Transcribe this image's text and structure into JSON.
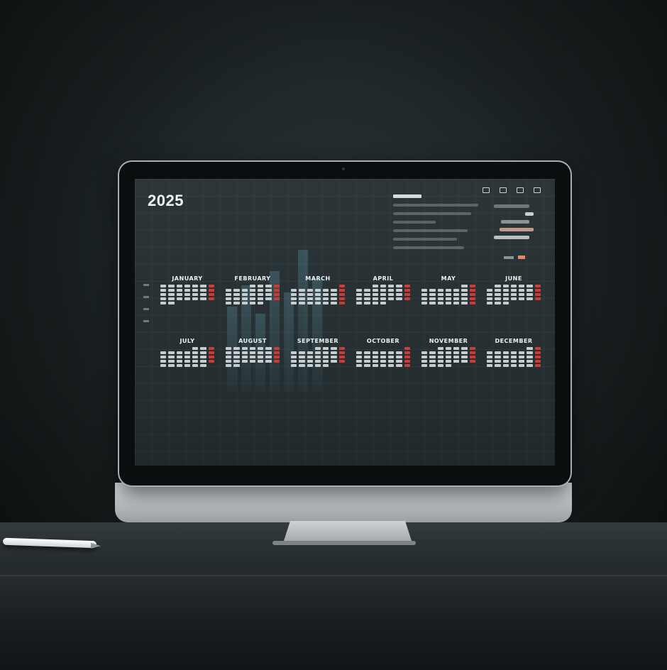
{
  "screen": {
    "year": "2025",
    "months": [
      {
        "name": "JANUARY"
      },
      {
        "name": "FEBRUARY"
      },
      {
        "name": "MARCH"
      },
      {
        "name": "APRIL"
      },
      {
        "name": "MAY"
      },
      {
        "name": "JUNE"
      },
      {
        "name": "JULY"
      },
      {
        "name": "AUGUST"
      },
      {
        "name": "SEPTEMBER"
      },
      {
        "name": "OCTOBER"
      },
      {
        "name": "NOVEMBER"
      },
      {
        "name": "DECEMBER"
      }
    ]
  },
  "colors": {
    "weekend": "#d03a34",
    "accent": "#e08a68",
    "screen_bg": "#263032"
  }
}
